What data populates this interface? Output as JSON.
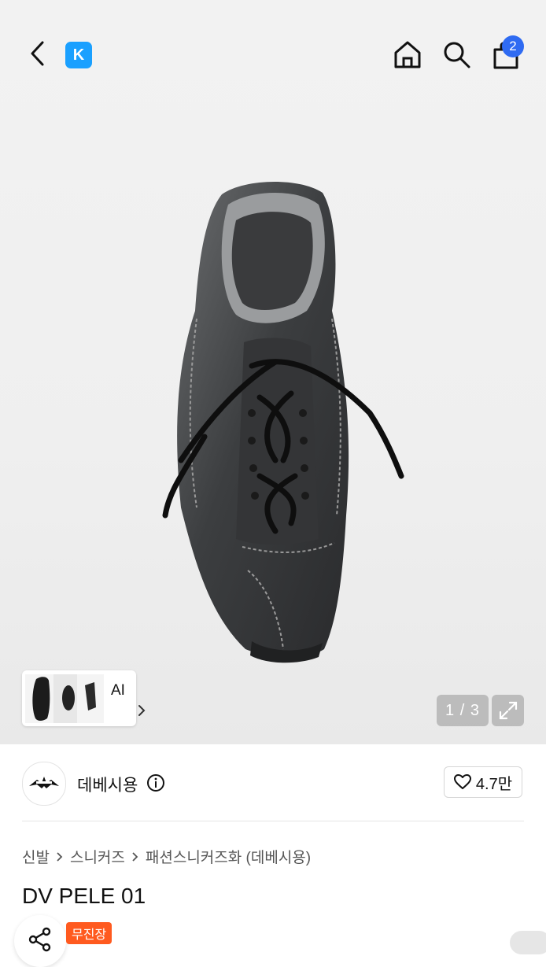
{
  "topbar": {
    "logo_letter": "K",
    "cart_count": "2"
  },
  "gallery": {
    "ai_label": "AI",
    "pager": "1 / 3"
  },
  "seller": {
    "name": "데베시용",
    "likes": "4.7만"
  },
  "breadcrumb": [
    "신발",
    "스니커즈",
    "패션스니커즈화 (데베시용)"
  ],
  "product": {
    "title": "DV PELE 01",
    "badge": "무진장"
  },
  "colors": {
    "logo_blue": "#1aa0ff",
    "badge_blue": "#2f6bf2",
    "badge_orange": "#ff5a1f"
  }
}
